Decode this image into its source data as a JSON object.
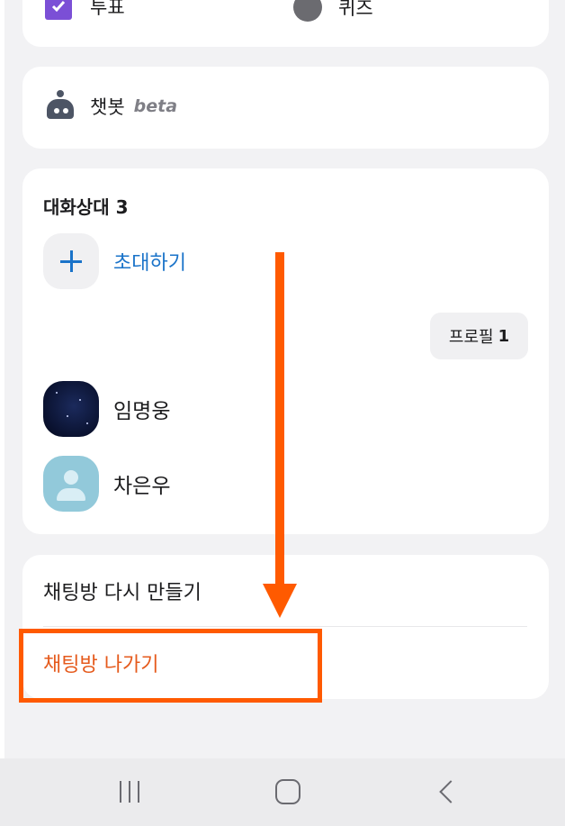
{
  "features": {
    "vote_label": "투표",
    "quiz_label": "퀴즈"
  },
  "chatbot": {
    "label": "챗봇",
    "badge": "beta"
  },
  "members": {
    "title": "대화상대 3",
    "invite_label": "초대하기",
    "profile_button": {
      "label": "프로필",
      "count": "1"
    },
    "list": [
      {
        "name": "임명웅",
        "avatar": "night-sky-avatar"
      },
      {
        "name": "차은우",
        "avatar": "default-person-avatar"
      }
    ]
  },
  "actions": {
    "remake_label": "채팅방 다시 만들기",
    "leave_label": "채팅방 나가기"
  },
  "colors": {
    "accent_blue": "#1a73c9",
    "leave_text": "#e55a1c",
    "annotation_orange": "#ff5a00",
    "vote_icon": "#7b4fd6"
  },
  "nav": {
    "icons": [
      "recent-apps-icon",
      "home-icon",
      "back-icon"
    ]
  }
}
